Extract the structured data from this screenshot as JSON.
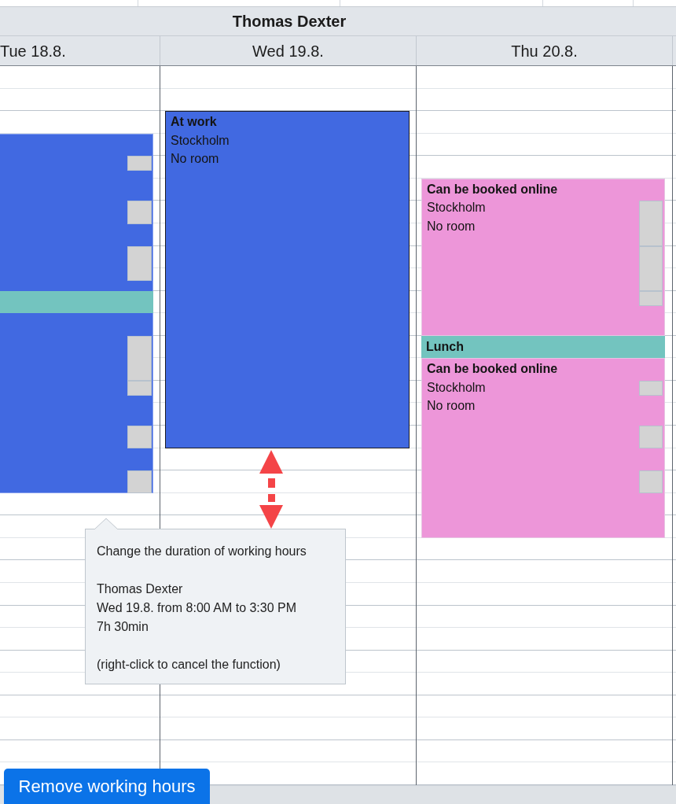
{
  "resource": {
    "name": "Thomas Dexter"
  },
  "days": [
    {
      "label": "Tue 18.8.",
      "events": [
        {
          "kind": "work",
          "selected": false
        },
        {
          "kind": "lunch",
          "selected": false
        }
      ]
    },
    {
      "label": "Wed 19.8.",
      "events": [
        {
          "kind": "work",
          "selected": true,
          "title": "At work",
          "location": "Stockholm",
          "room": "No room"
        }
      ]
    },
    {
      "label": "Thu 20.8.",
      "events": [
        {
          "kind": "online",
          "selected": false,
          "title": "Can be booked online",
          "location": "Stockholm",
          "room": "No room"
        },
        {
          "kind": "lunch",
          "selected": false,
          "title": "Lunch"
        },
        {
          "kind": "online",
          "selected": false,
          "title": "Can be booked online",
          "location": "Stockholm",
          "room": "No room"
        }
      ]
    }
  ],
  "tooltip": {
    "title": "Change the duration of working hours",
    "person": "Thomas Dexter",
    "time": "Wed 19.8. from 8:00 AM to 3:30 PM",
    "duration": "7h 30min",
    "hint": "(right-click to cancel the function)"
  },
  "button": {
    "label": "Remove working hours"
  }
}
